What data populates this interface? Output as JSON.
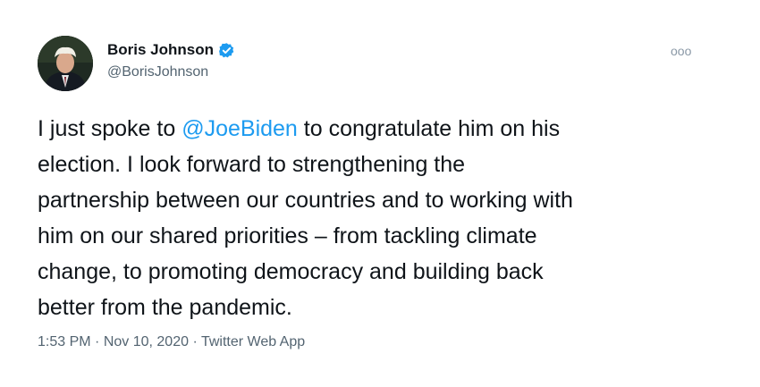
{
  "author": {
    "display_name": "Boris Johnson",
    "handle": "@BorisJohnson",
    "verified_icon": "verified-badge-icon"
  },
  "more_menu": {
    "label": "ooo",
    "icon": "more-options-icon"
  },
  "tweet": {
    "lines": [
      {
        "before": "I just spoke to ",
        "mention": "@JoeBiden",
        "after": " to congratulate him on his"
      },
      {
        "text": "election. I look forward to strengthening the"
      },
      {
        "text": "partnership between our countries and to working with"
      },
      {
        "text": "him on our shared priorities – from tackling climate"
      },
      {
        "text": "change, to promoting democracy and building back"
      },
      {
        "text": "better from the pandemic."
      }
    ]
  },
  "meta": {
    "time": "1:53 PM",
    "separator": " · ",
    "date": "Nov 10, 2020",
    "source": "Twitter Web App"
  },
  "colors": {
    "mention": "#1d9bf0",
    "verified": "#1d9bf0",
    "secondary_text": "#536471"
  }
}
